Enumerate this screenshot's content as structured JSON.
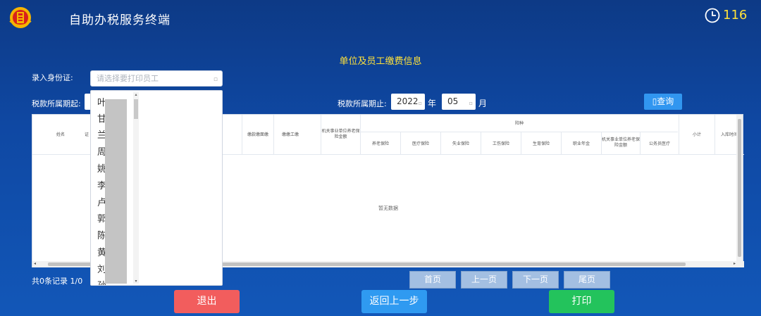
{
  "header": {
    "title": "自助办税服务终端",
    "timer": "116"
  },
  "page_title": "单位及员工缴费信息",
  "form": {
    "id_label": "录入身份证:",
    "employee_placeholder": "请选择要打印员工",
    "period_start_label": "税款所属期起:",
    "period_end_label": "税款所属期止:",
    "end_year": "2022",
    "year_unit": "年",
    "end_month": "05",
    "month_unit": "月",
    "query_label": "查询"
  },
  "table": {
    "headers": {
      "name": "姓名",
      "id": "证",
      "pay_base": "缴款缴面缴",
      "avg_wage": "缴缴工缴",
      "org_pension_base": "机关事业单位养老保险金额",
      "types": "险种",
      "pension": "养老保险",
      "medical": "医疗保险",
      "unemployment": "失业保险",
      "injury": "工伤保险",
      "maternity": "生育保险",
      "occupational": "职业年金",
      "org_pension": "机关事业单位养老保险金额",
      "civil_medical": "公务员医疗",
      "subtotal": "小计",
      "entry_time": "入库时间"
    },
    "empty_text": "暂无数据"
  },
  "footer": {
    "records_text": "共0条记录  1/0",
    "first": "首页",
    "prev": "上一页",
    "next": "下一页",
    "last": "尾页"
  },
  "actions": {
    "exit": "退出",
    "back": "返回上一步",
    "print": "打印"
  },
  "dropdown": {
    "items": [
      "叶",
      "甘",
      "兰",
      "周",
      "姚",
      "李",
      "卢",
      "郭",
      "陈",
      "黄",
      "刘",
      "孙"
    ]
  },
  "colors": {
    "accent_yellow": "#ffe23a",
    "exit_red": "#f25d5d",
    "back_blue": "#2f9af1",
    "print_green": "#23c35c"
  }
}
